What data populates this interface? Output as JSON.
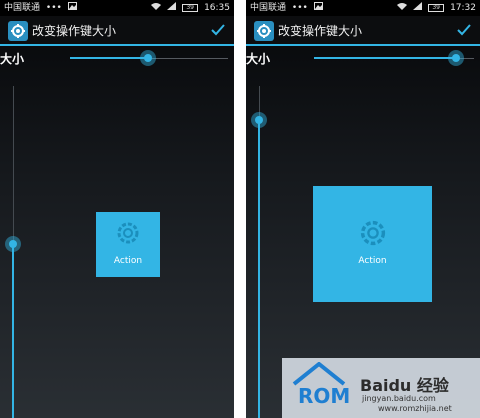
{
  "screens": {
    "left": {
      "status": {
        "carrier": "中国联通",
        "dots": "•••",
        "time": "16:35",
        "battery": "39"
      },
      "title": "改变操作键大小",
      "size_label": "大小",
      "horizontal_slider_value": 0.53,
      "vertical_slider_value": 0.55,
      "button_label": "Action"
    },
    "right": {
      "status": {
        "carrier": "中国联通",
        "dots": "•••",
        "time": "17:32",
        "battery": "39"
      },
      "title": "改变操作键大小",
      "size_label": "大小",
      "horizontal_slider_value": 0.96,
      "vertical_slider_value": 0.9,
      "button_label": "Action"
    }
  },
  "watermark": {
    "rom": "ROM",
    "baidu": "Baidu 经验",
    "jingyan": "jingyan.baidu.com",
    "zhijia": "www.romzhijia.net"
  },
  "colors": {
    "accent": "#33b5e5",
    "status_bar": "#000000",
    "action_bar": "#0c0d0f"
  },
  "icons": [
    "picture-icon",
    "wifi-icon",
    "signal-icon",
    "battery-icon",
    "gear-icon",
    "check-icon",
    "house-icon"
  ]
}
